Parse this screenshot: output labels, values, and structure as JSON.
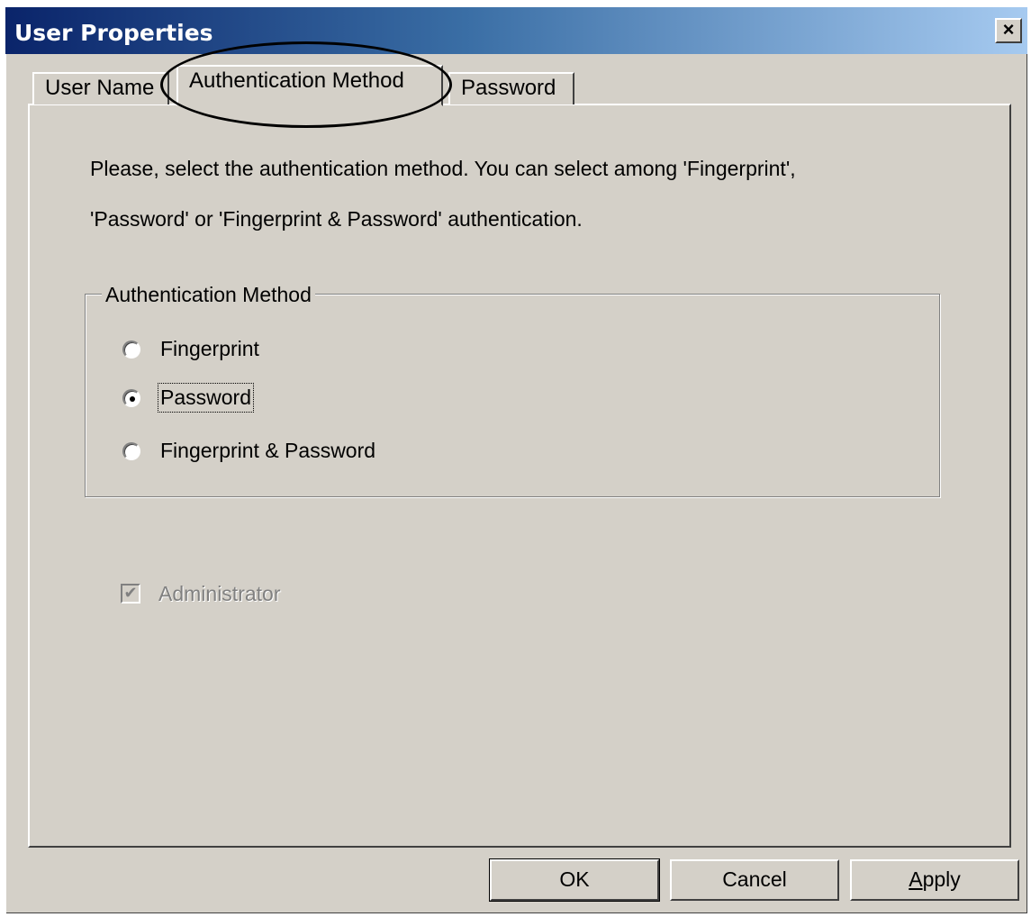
{
  "window": {
    "title": "User Properties",
    "close_glyph": "×"
  },
  "tabs": [
    {
      "label": "User Name",
      "active": false
    },
    {
      "label": "Authentication Method",
      "active": true
    },
    {
      "label": "Password",
      "active": false
    }
  ],
  "description": {
    "line1": "Please, select the authentication method. You can select among 'Fingerprint',",
    "line2": "'Password' or 'Fingerprint & Password' authentication."
  },
  "auth_group": {
    "legend": "Authentication Method",
    "options": [
      {
        "label": "Fingerprint",
        "selected": false
      },
      {
        "label": "Password",
        "selected": true
      },
      {
        "label": "Fingerprint & Password",
        "selected": false
      }
    ]
  },
  "administrator": {
    "label": "Administrator",
    "checked": true,
    "disabled": true,
    "check_glyph": "✔"
  },
  "buttons": {
    "ok": "OK",
    "cancel": "Cancel",
    "apply": "Apply"
  },
  "annotation": {
    "type": "ellipse-highlight",
    "target": "Authentication Method tab"
  },
  "colors": {
    "dialog_bg": "#d4d0c8",
    "title_gradient_start": "#0a246a",
    "title_gradient_end": "#a6caf0",
    "disabled_text": "#808080"
  }
}
